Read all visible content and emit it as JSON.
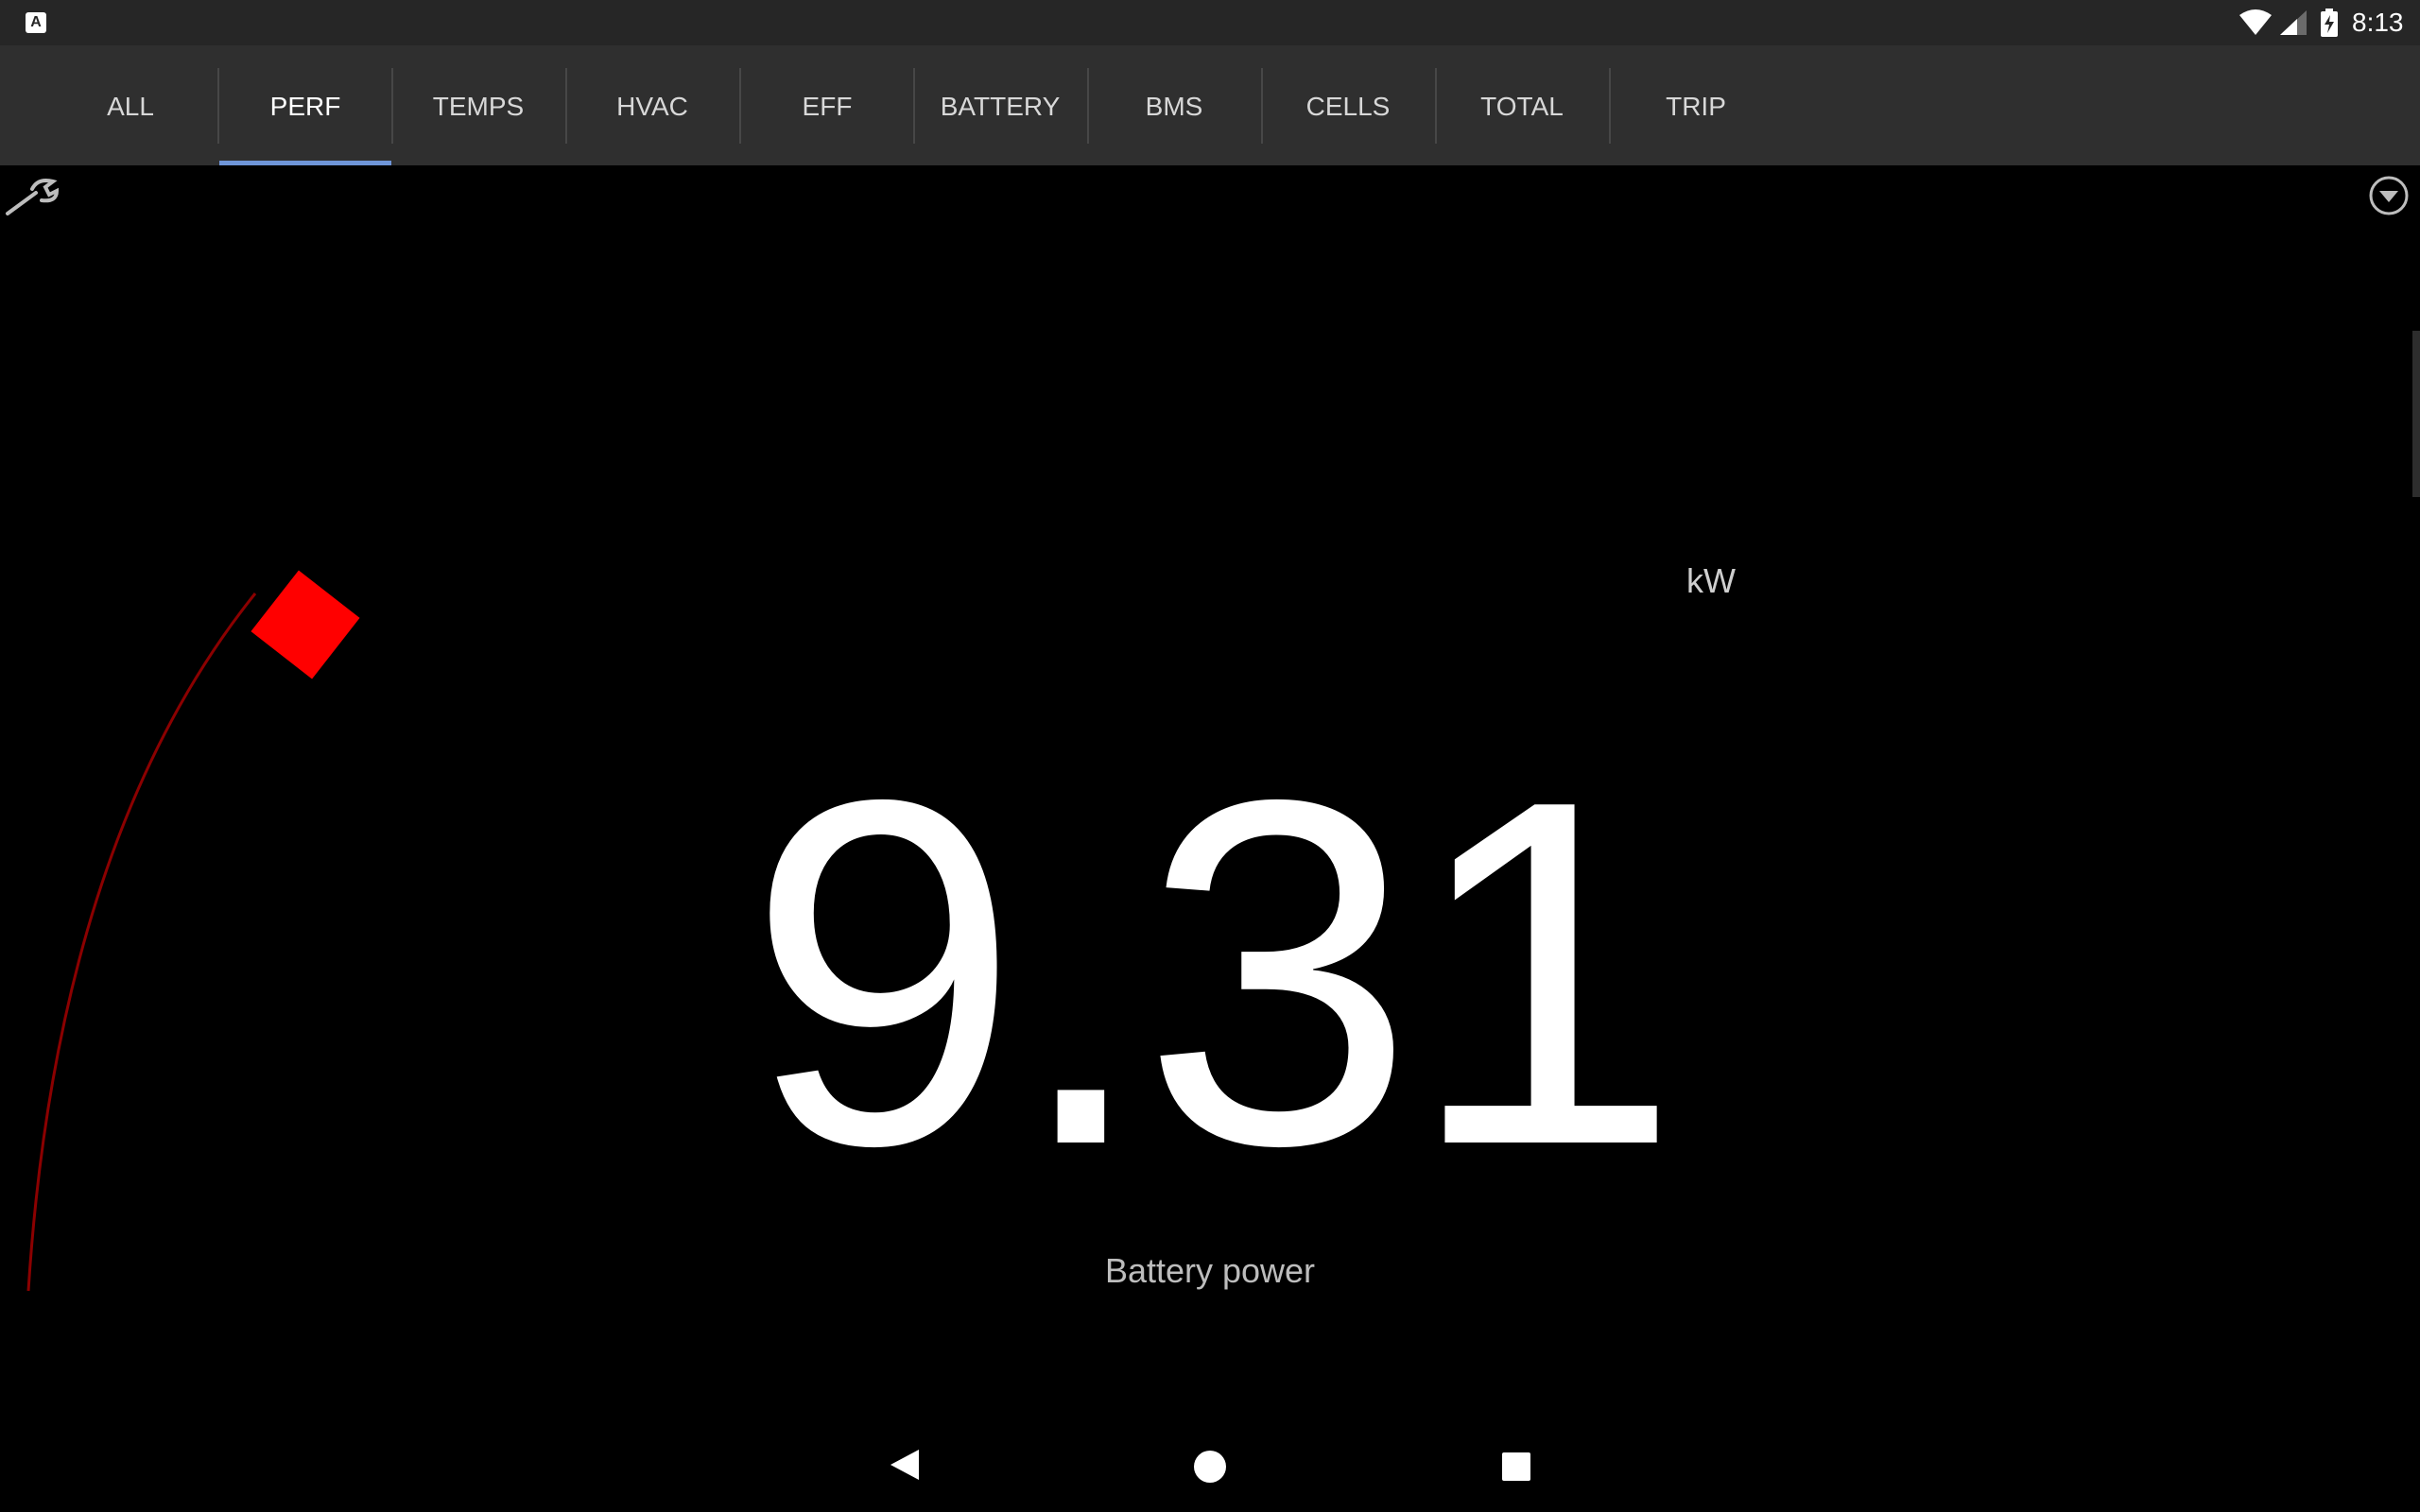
{
  "status_bar": {
    "app_icon_glyph": "A",
    "time": "8:13",
    "icons": [
      "wifi-icon",
      "signal-icon",
      "battery-charging-icon"
    ]
  },
  "tabs": [
    {
      "label": "ALL",
      "active": false
    },
    {
      "label": "PERF",
      "active": true
    },
    {
      "label": "TEMPS",
      "active": false
    },
    {
      "label": "HVAC",
      "active": false
    },
    {
      "label": "EFF",
      "active": false
    },
    {
      "label": "BATTERY",
      "active": false
    },
    {
      "label": "BMS",
      "active": false
    },
    {
      "label": "CELLS",
      "active": false
    },
    {
      "label": "TOTAL",
      "active": false
    },
    {
      "label": "TRIP",
      "active": false
    }
  ],
  "toolbar": {
    "settings_icon": "wrench-icon",
    "menu_icon": "dropdown-icon"
  },
  "gauge": {
    "value": "9.31",
    "unit": "kW",
    "caption": "Battery power",
    "arc_color": "#8b0000",
    "marker_color": "#ff0000"
  },
  "nav_bar": {
    "icons": [
      "back-icon",
      "home-icon",
      "recents-icon"
    ]
  },
  "colors": {
    "background": "#000000",
    "status_bar": "#262626",
    "tab_bar": "#2f2f2f",
    "tab_indicator": "#6e95d8",
    "tab_text_active": "#ffffff",
    "tab_text": "#d8d8d8"
  }
}
